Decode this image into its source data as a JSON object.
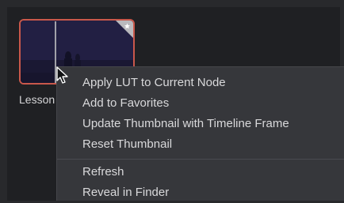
{
  "clip": {
    "label": "Lesson",
    "favorite_icon": "star-icon",
    "border_color": "#c9584b"
  },
  "context_menu": {
    "groups": [
      {
        "items": [
          {
            "label": "Apply LUT to Current Node"
          },
          {
            "label": "Add to Favorites"
          },
          {
            "label": "Update Thumbnail with Timeline Frame"
          },
          {
            "label": "Reset Thumbnail"
          }
        ]
      },
      {
        "items": [
          {
            "label": "Refresh"
          },
          {
            "label": "Reveal in Finder"
          }
        ]
      }
    ]
  },
  "cursor": {
    "icon": "mouse-pointer-icon"
  }
}
